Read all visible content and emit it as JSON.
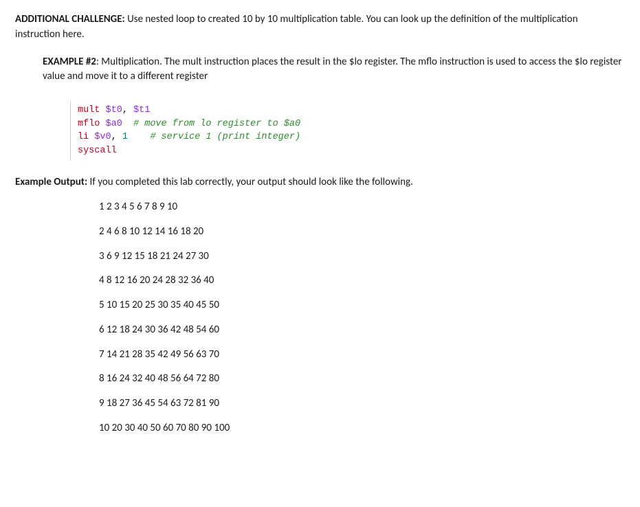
{
  "challenge": {
    "label": "ADDITIONAL CHALLENGE:",
    "text": " Use nested loop to created 10 by 10 multiplication table.  You can look up the definition of the multiplication instruction here."
  },
  "example2": {
    "label": "EXAMPLE #2",
    "colon_title": ": Multiplication.  The mult instruction places the result in the $lo register.  The mflo instruction is used to access the $lo register value and move it to a different register"
  },
  "code": {
    "l1_kw": "mult ",
    "l1_r1": "$t0",
    "l1_comma": ", ",
    "l1_r2": "$t1",
    "l2_kw": "mflo ",
    "l2_r1": "$a0",
    "l2_sp": "  ",
    "l2_cm": "# move from lo register to $a0",
    "l3_kw": "li ",
    "l3_r1": "$v0",
    "l3_mid": ", ",
    "l3_n": "1",
    "l3_sp": "    ",
    "l3_cm": "# service 1 (print integer)",
    "l4_kw": "syscall"
  },
  "output": {
    "label": "Example Output:",
    "text": " If you completed this lab correctly, your output should look like the following.",
    "rows": [
      "1 2 3 4 5 6 7 8 9 10",
      "2 4 6 8 10 12 14 16 18 20",
      "3 6 9 12 15 18 21 24 27 30",
      "4 8 12 16 20 24 28 32 36 40",
      "5 10 15 20 25 30 35 40 45 50",
      "6 12 18 24 30 36 42 48 54 60",
      "7 14 21 28 35 42 49 56 63 70",
      "8 16 24 32 40 48 56 64 72 80",
      "9 18 27 36 45 54 63 72 81 90",
      "10 20 30 40 50 60 70 80 90 100"
    ]
  },
  "chart_data": {
    "type": "table",
    "title": "10x10 multiplication table",
    "rows": 10,
    "cols": 10,
    "data": [
      [
        1,
        2,
        3,
        4,
        5,
        6,
        7,
        8,
        9,
        10
      ],
      [
        2,
        4,
        6,
        8,
        10,
        12,
        14,
        16,
        18,
        20
      ],
      [
        3,
        6,
        9,
        12,
        15,
        18,
        21,
        24,
        27,
        30
      ],
      [
        4,
        8,
        12,
        16,
        20,
        24,
        28,
        32,
        36,
        40
      ],
      [
        5,
        10,
        15,
        20,
        25,
        30,
        35,
        40,
        45,
        50
      ],
      [
        6,
        12,
        18,
        24,
        30,
        36,
        42,
        48,
        54,
        60
      ],
      [
        7,
        14,
        21,
        28,
        35,
        42,
        49,
        56,
        63,
        70
      ],
      [
        8,
        16,
        24,
        32,
        40,
        48,
        56,
        64,
        72,
        80
      ],
      [
        9,
        18,
        27,
        36,
        45,
        54,
        63,
        72,
        81,
        90
      ],
      [
        10,
        20,
        30,
        40,
        50,
        60,
        70,
        80,
        90,
        100
      ]
    ]
  }
}
